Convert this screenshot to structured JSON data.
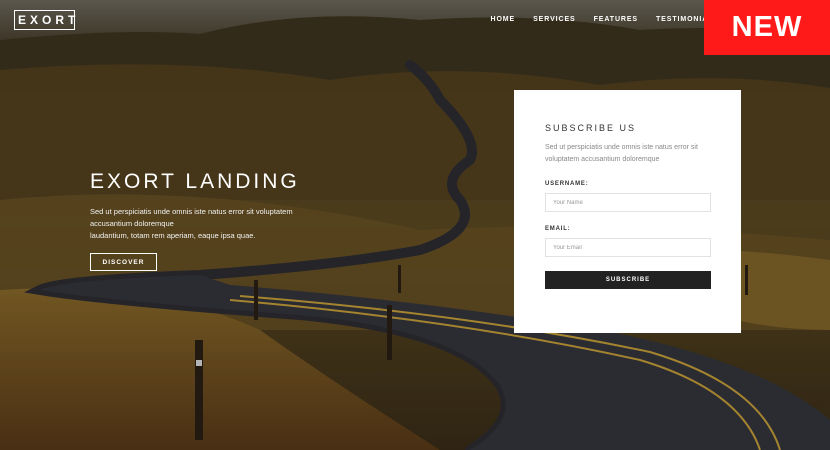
{
  "brand": {
    "logo": "EXORT"
  },
  "nav": {
    "items": [
      "HOME",
      "SERVICES",
      "FEATURES",
      "TESTIMONIALS"
    ]
  },
  "badge": "NEW",
  "hero": {
    "title": "EXORT LANDING",
    "text_line1": "Sed ut perspiciatis unde omnis iste natus error sit voluptatem accusantium doloremque",
    "text_line2": "laudantium, totam rem aperiam, eaque ipsa quae.",
    "button": "DISCOVER"
  },
  "subscribe": {
    "title": "SUBSCRIBE US",
    "text": "Sed ut perspiciatis unde omnis iste natus error sit voluptatem accusantium doloremque",
    "username_label": "USERNAME:",
    "username_placeholder": "Your Name",
    "email_label": "EMAIL:",
    "email_placeholder": "Your Email",
    "button": "SUBSCRIBE"
  },
  "colors": {
    "badge": "#ff1a1a",
    "button_dark": "#222222"
  }
}
